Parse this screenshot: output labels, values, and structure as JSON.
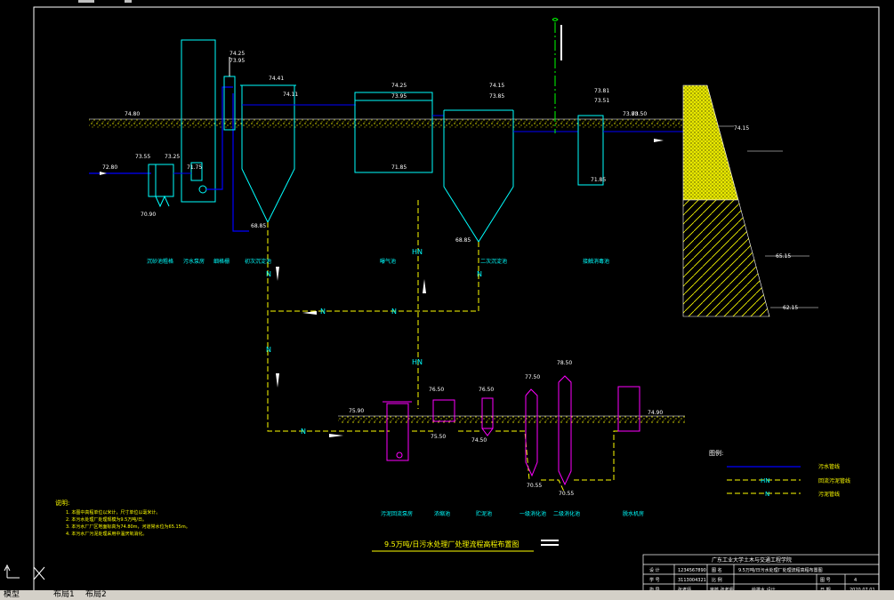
{
  "colors": {
    "background": "#000000",
    "border": "#ffffff",
    "cyan": "#00ffff",
    "blue": "#0000ff",
    "yellow": "#ffff00",
    "green": "#00ff00",
    "magenta": "#ff00ff",
    "white": "#ffffff"
  },
  "ground_levels": {
    "l1": "74.80",
    "l2": "74.80",
    "l3": "74.80",
    "l4": "73.80"
  },
  "elevations": {
    "inlet": "72.80",
    "grit_top1": "73.55",
    "grit_top2": "73.25",
    "grit_bottom": "70.90",
    "screen_top1": "74.25",
    "screen_top2": "73.95",
    "pump_well": "71.75",
    "lift_top1": "74.50",
    "lift_top2": "74.20",
    "lift_bottom": "71.75",
    "sed_top1": "74.41",
    "sed_top2": "74.11",
    "sed_bottom": "68.85",
    "aer_top1": "74.25",
    "aer_top2": "73.95",
    "aer_bottom": "71.85",
    "sec_top1": "74.15",
    "sec_top2": "73.85",
    "sec_bottom": "68.85",
    "dis_top1": "73.81",
    "dis_top2": "73.51",
    "dis_bottom": "71.85",
    "outlet": "73.50",
    "river_high": "74.15",
    "river_normal": "65.15",
    "river_low": "62.15",
    "sludge_ground": "75.90",
    "sludge_ground_right": "74.90",
    "thick_top": "76.50",
    "thick_bot": "75.50",
    "conc_top": "76.50",
    "conc_bot": "74.50",
    "dig1_top": "77.50",
    "dig1_bot": "70.55",
    "dig2_top": "78.50",
    "dig2_bot": "70.55"
  },
  "process_labels": {
    "grit": "沉砂池粗格",
    "pump": "污水泵房",
    "screen": "细格栅",
    "primary": "初次沉淀池",
    "aeration": "曝气池",
    "secondary": "二次沉淀池",
    "disinfection": "接触消毒池",
    "sludge_well": "污泥回流泵房",
    "thickener": "浓缩池",
    "storage": "贮泥池",
    "digester1": "一级消化池",
    "digester2": "二级消化池",
    "dewatering": "脱水机房"
  },
  "pipe_letters": {
    "n": "N",
    "hn": "HN"
  },
  "legend": {
    "title": "图例:",
    "items": [
      {
        "label": "污水管线"
      },
      {
        "label": "回流污泥管线"
      },
      {
        "label": "污泥管线"
      }
    ]
  },
  "notes": {
    "title": "说明:",
    "lines": [
      "1. 本图中高程单位以米计，尺寸单位以毫米计。",
      "2. 本污水处理厂处理规模为9.5万吨/日。",
      "3. 本污水厂厂区地面标高为74.80m，河道常水位为65.15m。",
      "4. 本污水厂污泥处理采用中温厌氧消化。"
    ]
  },
  "drawing_title": "9.5万吨/日污水处理厂处理流程高程布置图",
  "title_block": {
    "header": "广东工业大学土木与交通工程学院",
    "r1": [
      "设 计",
      "1234567890",
      "图 名",
      "9.5万吨/日污水处理厂处理流程高程布置图",
      "",
      ""
    ],
    "r2": [
      "学 号",
      "3113004321",
      "比 例",
      "",
      "图 号",
      "4"
    ],
    "r3": [
      "指 导",
      "张老师",
      "审核 张老师",
      "给排水 设计",
      "日 期",
      "2020.07.01"
    ]
  },
  "status_tabs": [
    "模型",
    "布局1",
    "布局2"
  ]
}
